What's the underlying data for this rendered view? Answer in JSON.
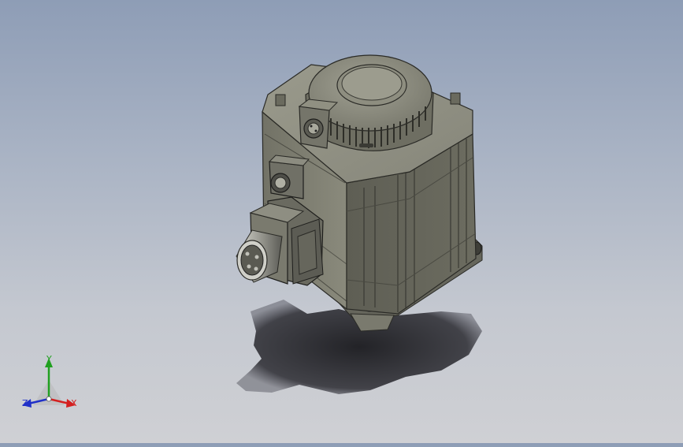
{
  "viewport": {
    "background_top": "#8e9db6",
    "background_bottom": "#cfd0d4"
  },
  "model": {
    "body_color": "#7b7b6e",
    "shadow_color": "#1e1e22"
  },
  "triad": {
    "x_label": "X",
    "y_label": "Y",
    "z_label": "Z",
    "x_color": "#d42020",
    "y_color": "#20a020",
    "z_color": "#2030c8"
  }
}
